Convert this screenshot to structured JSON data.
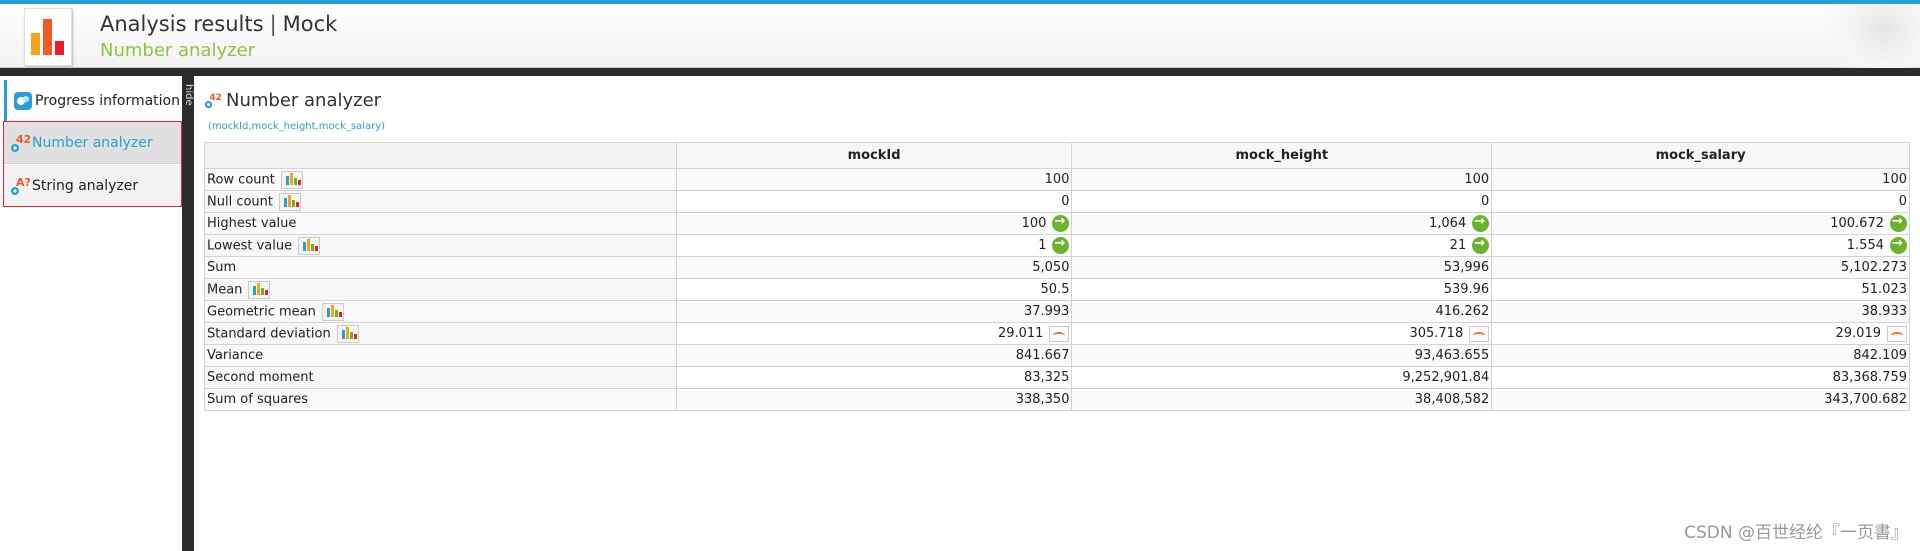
{
  "header": {
    "title": "Analysis results",
    "separator": "|",
    "job_name": "Mock",
    "subtitle": "Number analyzer"
  },
  "sidebar": {
    "items": [
      {
        "label": "Progress information",
        "icon": "progress-icon"
      },
      {
        "label": "Number analyzer",
        "icon": "number-analyzer-icon"
      },
      {
        "label": "String analyzer",
        "icon": "string-analyzer-icon"
      }
    ]
  },
  "splitter": {
    "label": "hide"
  },
  "panel": {
    "title": "Number analyzer",
    "columns_link": "(mockId,mock_height,mock_salary)"
  },
  "table": {
    "columns": [
      "mockId",
      "mock_height",
      "mock_salary"
    ],
    "rows": [
      {
        "label": "Row count",
        "values": [
          "100",
          "100",
          "100"
        ]
      },
      {
        "label": "Null count",
        "values": [
          "0",
          "0",
          "0"
        ]
      },
      {
        "label": "Highest value",
        "values": [
          "100",
          "1,064",
          "100.672"
        ]
      },
      {
        "label": "Lowest value",
        "values": [
          "1",
          "21",
          "1.554"
        ]
      },
      {
        "label": "Sum",
        "values": [
          "5,050",
          "53,996",
          "5,102.273"
        ]
      },
      {
        "label": "Mean",
        "values": [
          "50.5",
          "539.96",
          "51.023"
        ]
      },
      {
        "label": "Geometric mean",
        "values": [
          "37.993",
          "416.262",
          "38.933"
        ]
      },
      {
        "label": "Standard deviation",
        "values": [
          "29.011",
          "305.718",
          "29.019"
        ]
      },
      {
        "label": "Variance",
        "values": [
          "841.667",
          "93,463.655",
          "842.109"
        ]
      },
      {
        "label": "Second moment",
        "values": [
          "83,325",
          "9,252,901.84",
          "83,368.759"
        ]
      },
      {
        "label": "Sum of squares",
        "values": [
          "338,350",
          "38,408,582",
          "343,700.682"
        ]
      }
    ]
  },
  "watermark": "CSDN @百世经纶『一页書』",
  "colors": {
    "accent_blue": "#2a9fd6",
    "subtitle_green": "#8cc63f",
    "go_green": "#6ab42d",
    "dark_bar": "#2b2b2b",
    "highlight_red": "#e22233"
  }
}
